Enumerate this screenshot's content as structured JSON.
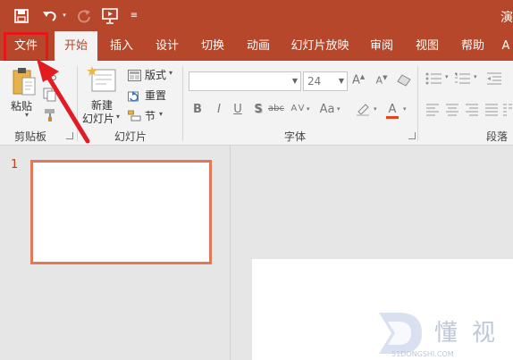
{
  "title_fragment": "演",
  "tabs": [
    {
      "label": "文件"
    },
    {
      "label": "开始"
    },
    {
      "label": "插入"
    },
    {
      "label": "设计"
    },
    {
      "label": "切换"
    },
    {
      "label": "动画"
    },
    {
      "label": "幻灯片放映"
    },
    {
      "label": "审阅"
    },
    {
      "label": "视图"
    },
    {
      "label": "帮助"
    },
    {
      "label": "A"
    }
  ],
  "clipboard": {
    "paste": "粘贴",
    "group": "剪贴板"
  },
  "slides": {
    "new_line1": "新建",
    "new_line2": "幻灯片",
    "layout": "版式",
    "reset": "重置",
    "section": "节",
    "group": "幻灯片"
  },
  "font": {
    "name_value": "",
    "size_value": "24",
    "group": "字体"
  },
  "paragraph": {
    "group": "段落"
  },
  "thumbnails": [
    {
      "number": "1"
    }
  ],
  "watermark": {
    "chars": "懂视",
    "url": "51DONGSHI.COM"
  },
  "colors": {
    "accent": "#b7472a",
    "highlight": "#e8151b",
    "arrow": "#e31b23",
    "slide_border": "#e2775a"
  }
}
